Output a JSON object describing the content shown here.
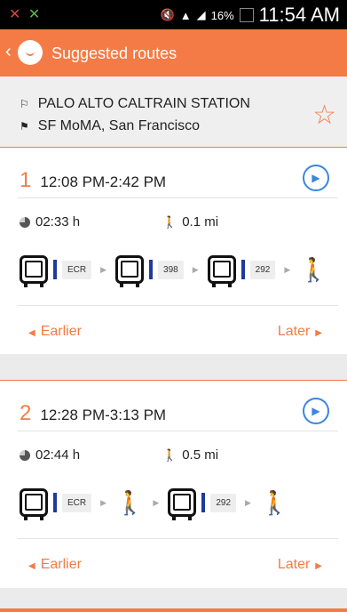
{
  "status_bar": {
    "left_icons": [
      "missed-call-icon",
      "signal-hidden-icon"
    ],
    "battery": "16%",
    "time": "11:54 AM"
  },
  "header": {
    "title": "Suggested routes"
  },
  "trip": {
    "from": "PALO ALTO CALTRAIN STATION",
    "to": "SF MoMA, San Francisco"
  },
  "routes": [
    {
      "index": "1",
      "times": "12:08 PM-2:42 PM",
      "duration": "02:33 h",
      "walk": "0.1 mi",
      "legs": [
        {
          "type": "bus",
          "route": "ECR"
        },
        {
          "type": "bus",
          "route": "398"
        },
        {
          "type": "bus",
          "route": "292"
        },
        {
          "type": "walk"
        }
      ],
      "earlier": "Earlier",
      "later": "Later"
    },
    {
      "index": "2",
      "times": "12:28 PM-3:13 PM",
      "duration": "02:44 h",
      "walk": "0.5 mi",
      "legs": [
        {
          "type": "bus",
          "route": "ECR"
        },
        {
          "type": "walk"
        },
        {
          "type": "bus",
          "route": "292"
        },
        {
          "type": "walk"
        }
      ],
      "earlier": "Earlier",
      "later": "Later"
    }
  ],
  "colors": {
    "accent": "#f47b45",
    "link": "#3a86e0",
    "route_bar": "#1e3a9e"
  }
}
